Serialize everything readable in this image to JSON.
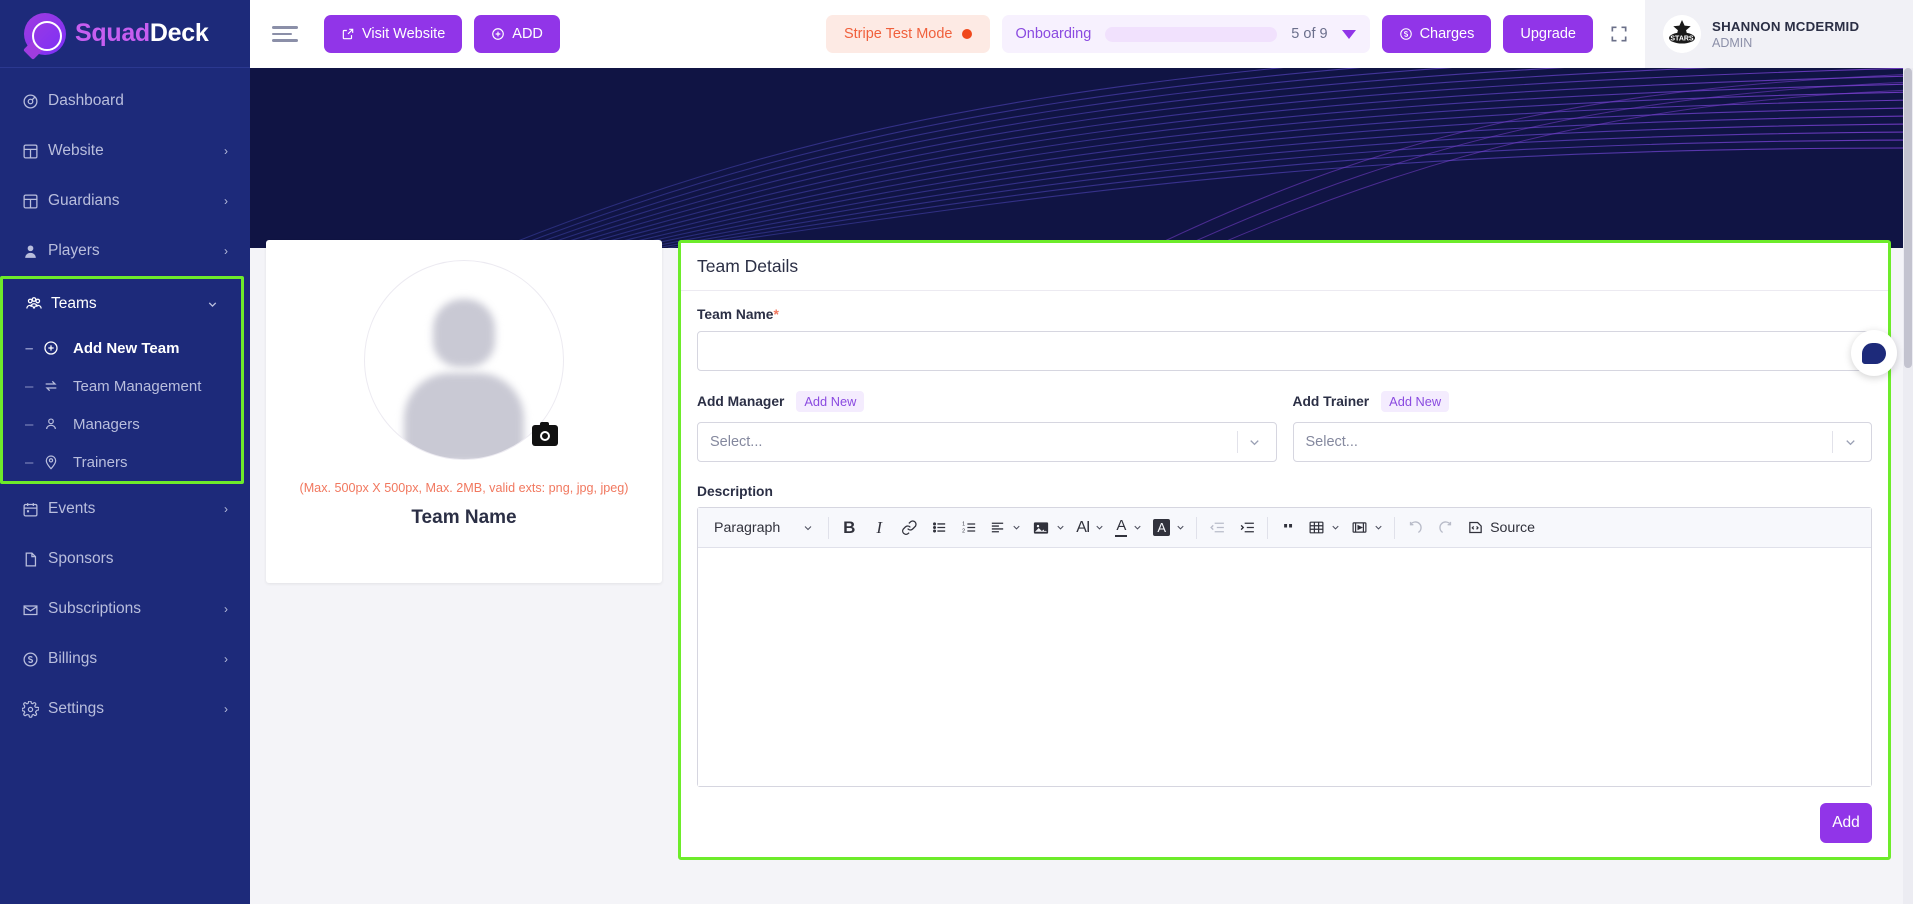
{
  "brand": {
    "part1": "Squad",
    "part2": "Deck",
    "logo_icon": "squaddeck-logo-icon"
  },
  "sidebar": {
    "items": [
      {
        "label": "Dashboard",
        "icon": "speedometer-icon",
        "has_chevron": false,
        "active": false
      },
      {
        "label": "Website",
        "icon": "layout-icon",
        "has_chevron": true,
        "active": false
      },
      {
        "label": "Guardians",
        "icon": "layout-icon",
        "has_chevron": true,
        "active": false
      },
      {
        "label": "Players",
        "icon": "user-icon",
        "has_chevron": true,
        "active": false
      },
      {
        "label": "Teams",
        "icon": "team-icon",
        "has_chevron": true,
        "active": true
      },
      {
        "label": "Events",
        "icon": "calendar-icon",
        "has_chevron": true,
        "active": false
      },
      {
        "label": "Sponsors",
        "icon": "document-icon",
        "has_chevron": false,
        "active": false
      },
      {
        "label": "Subscriptions",
        "icon": "envelope-icon",
        "has_chevron": true,
        "active": false
      },
      {
        "label": "Billings",
        "icon": "coin-icon",
        "has_chevron": true,
        "active": false
      },
      {
        "label": "Settings",
        "icon": "gear-icon",
        "has_chevron": true,
        "active": false
      }
    ],
    "teams_submenu": [
      {
        "label": "Add New Team",
        "icon": "plus-circle-icon",
        "bold": true
      },
      {
        "label": "Team Management",
        "icon": "transfer-icon",
        "bold": false
      },
      {
        "label": "Managers",
        "icon": "user-outline-icon",
        "bold": false
      },
      {
        "label": "Trainers",
        "icon": "location-pin-user-icon",
        "bold": false
      }
    ],
    "chevron_glyph": "›",
    "expanded_chevron_glyph": "⌄",
    "dash_glyph": "–",
    "highlight_color": "#6dec2a"
  },
  "topbar": {
    "menu_toggle_icon": "hamburger-icon",
    "visit_website_label": "Visit Website",
    "visit_website_icon": "external-link-icon",
    "add_label": "ADD",
    "add_icon": "plus-circle-icon",
    "stripe_label": "Stripe Test Mode",
    "stripe_dot_color": "#f0481c",
    "stripe_bg": "#fdeae4",
    "onboarding_label": "Onboarding",
    "onboarding_progress_percent": 56,
    "onboarding_count": "5 of 9",
    "onboarding_caret_icon": "caret-down-icon",
    "charges_label": "Charges",
    "charges_icon": "coin-icon",
    "upgrade_label": "Upgrade",
    "fullscreen_icon": "expand-icon",
    "accent_color": "#9135e8",
    "user": {
      "name": "SHANNON MCDERMID",
      "role": "ADMIN",
      "avatar_text": "STARS",
      "avatar_icon": "stars-team-logo-icon"
    }
  },
  "photo_card": {
    "avatar_icon": "person-placeholder-icon",
    "camera_icon": "camera-icon",
    "hint": "(Max. 500px X 500px, Max. 2MB, valid exts: png, jpg, jpeg)",
    "title": "Team Name"
  },
  "form": {
    "header": "Team Details",
    "team_name_label": "Team Name",
    "required_marker": "*",
    "team_name_value": "",
    "team_name_placeholder": "",
    "manager": {
      "label": "Add Manager",
      "add_new": "Add New",
      "select_placeholder": "Select..."
    },
    "trainer": {
      "label": "Add Trainer",
      "add_new": "Add New",
      "select_placeholder": "Select..."
    },
    "description_label": "Description",
    "description_value": "",
    "submit_label": "Add",
    "toolbar": [
      {
        "name": "paragraph-style-dropdown",
        "label": "Paragraph",
        "glyph": "",
        "caret": true
      },
      {
        "name": "bold-button",
        "label": "",
        "glyph": "B",
        "caret": false
      },
      {
        "name": "italic-button",
        "label": "",
        "glyph": "I",
        "caret": false
      },
      {
        "name": "link-button",
        "label": "",
        "glyph": "link",
        "caret": false
      },
      {
        "name": "bulleted-list-button",
        "label": "",
        "glyph": "ul",
        "caret": false
      },
      {
        "name": "numbered-list-button",
        "label": "",
        "glyph": "ol",
        "caret": false
      },
      {
        "name": "text-align-button",
        "label": "",
        "glyph": "align",
        "caret": true
      },
      {
        "name": "insert-image-button",
        "label": "",
        "glyph": "image",
        "caret": true
      },
      {
        "name": "font-size-button",
        "label": "",
        "glyph": "AI",
        "caret": true
      },
      {
        "name": "font-color-button",
        "label": "",
        "glyph": "A-underline",
        "caret": true
      },
      {
        "name": "highlight-color-button",
        "label": "",
        "glyph": "A-box",
        "caret": true
      },
      {
        "name": "decrease-indent-button",
        "label": "",
        "glyph": "outdent",
        "caret": false
      },
      {
        "name": "increase-indent-button",
        "label": "",
        "glyph": "indent",
        "caret": false
      },
      {
        "name": "block-quote-button",
        "label": "",
        "glyph": "quote",
        "caret": false
      },
      {
        "name": "insert-table-button",
        "label": "",
        "glyph": "table",
        "caret": true
      },
      {
        "name": "insert-media-button",
        "label": "",
        "glyph": "media",
        "caret": true
      },
      {
        "name": "undo-button",
        "label": "",
        "glyph": "undo",
        "caret": false
      },
      {
        "name": "redo-button",
        "label": "",
        "glyph": "redo",
        "caret": false
      },
      {
        "name": "source-button",
        "label": "Source",
        "glyph": "source",
        "caret": false
      }
    ]
  },
  "chat": {
    "icon": "chat-bubble-icon"
  }
}
